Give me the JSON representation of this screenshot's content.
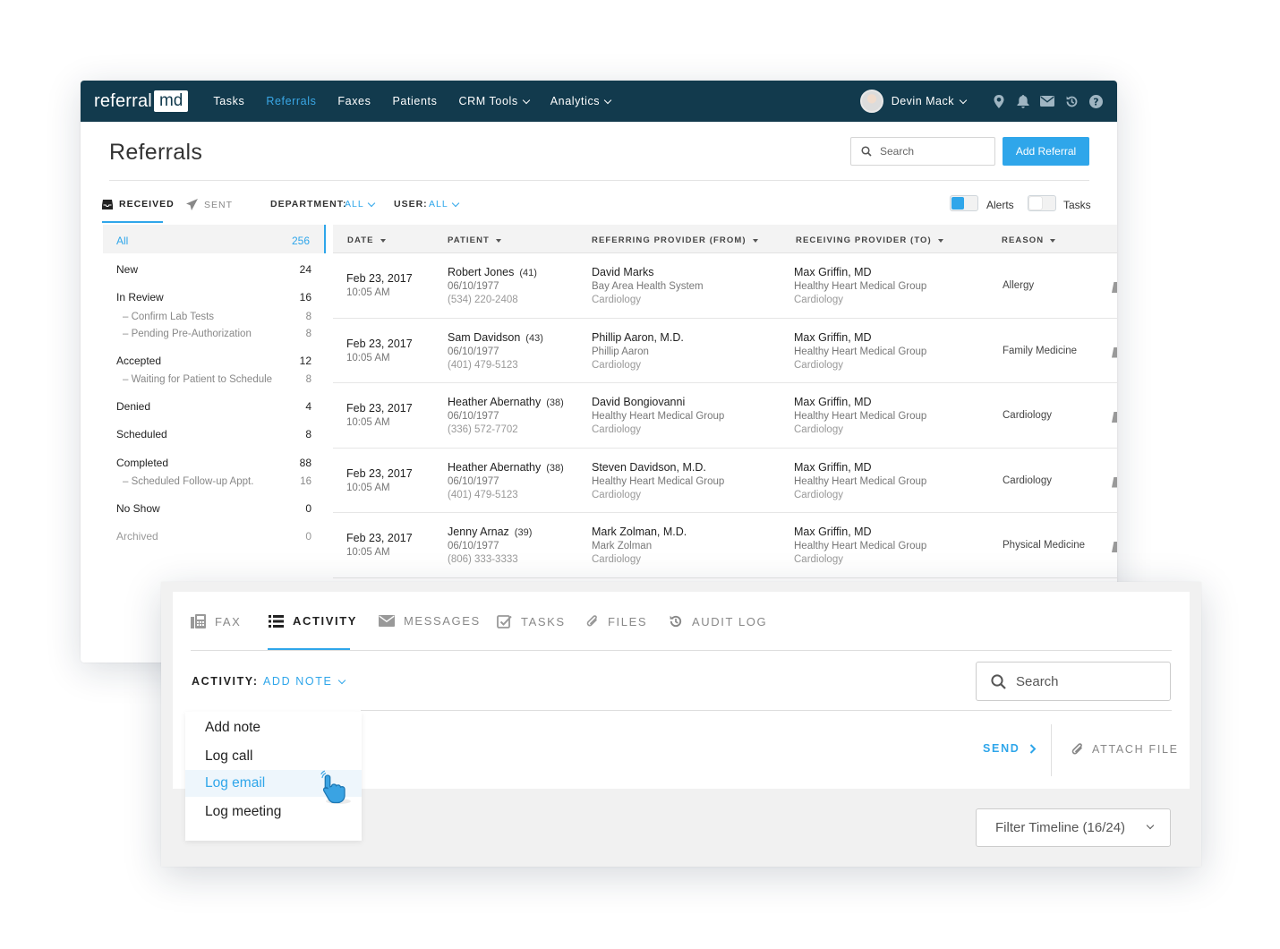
{
  "app": {
    "logo_text": "referral",
    "logo_box": "md"
  },
  "nav": {
    "items": [
      {
        "label": "Tasks",
        "active": false,
        "dropdown": false
      },
      {
        "label": "Referrals",
        "active": true,
        "dropdown": false
      },
      {
        "label": "Faxes",
        "active": false,
        "dropdown": false
      },
      {
        "label": "Patients",
        "active": false,
        "dropdown": false
      },
      {
        "label": "CRM Tools",
        "active": false,
        "dropdown": true
      },
      {
        "label": "Analytics",
        "active": false,
        "dropdown": true
      }
    ],
    "user_name": "Devin Mack",
    "icons": [
      "location-icon",
      "bell-icon",
      "mail-icon",
      "history-icon",
      "help-icon"
    ]
  },
  "header": {
    "title": "Referrals",
    "search_placeholder": "Search",
    "add_button": "Add Referral"
  },
  "filters": {
    "received": "RECEIVED",
    "sent": "SENT",
    "department_label": "DEPARTMENT:",
    "department_value": "ALL",
    "user_label": "USER:",
    "user_value": "ALL",
    "alerts_label": "Alerts",
    "alerts_on": true,
    "tasks_label": "Tasks",
    "tasks_on": false
  },
  "status_list": [
    {
      "label": "All",
      "count": "256",
      "type": "active"
    },
    {
      "label": "New",
      "count": "24",
      "type": "main"
    },
    {
      "label": "In Review",
      "count": "16",
      "type": "main"
    },
    {
      "label": "– Confirm Lab Tests",
      "count": "8",
      "type": "sub"
    },
    {
      "label": "– Pending Pre-Authorization",
      "count": "8",
      "type": "sub"
    },
    {
      "label": "Accepted",
      "count": "12",
      "type": "main"
    },
    {
      "label": "– Waiting for Patient to Schedule",
      "count": "8",
      "type": "sub"
    },
    {
      "label": "Denied",
      "count": "4",
      "type": "main"
    },
    {
      "label": "Scheduled",
      "count": "8",
      "type": "main"
    },
    {
      "label": "Completed",
      "count": "88",
      "type": "main"
    },
    {
      "label": "– Scheduled Follow-up Appt.",
      "count": "16",
      "type": "sub"
    },
    {
      "label": "No Show",
      "count": "0",
      "type": "main"
    },
    {
      "label": "Archived",
      "count": "0",
      "type": "muted"
    }
  ],
  "table": {
    "headers": [
      "DATE",
      "PATIENT",
      "REFERRING PROVIDER (FROM)",
      "RECEIVING PROVIDER (TO)",
      "REASON"
    ],
    "rows": [
      {
        "date": "Feb 23, 2017",
        "time": "10:05 AM",
        "patient": "Robert Jones",
        "age": "(41)",
        "dob": "06/10/1977",
        "phone": "(534) 220-2408",
        "from_name": "David Marks",
        "from_org": "Bay Area Health System",
        "from_dept": "Cardiology",
        "to_name": "Max Griffin, MD",
        "to_org": "Healthy Heart Medical Group",
        "to_dept": "Cardiology",
        "reason": "Allergy"
      },
      {
        "date": "Feb 23, 2017",
        "time": "10:05 AM",
        "patient": "Sam Davidson",
        "age": "(43)",
        "dob": "06/10/1977",
        "phone": "(401) 479-5123",
        "from_name": "Phillip Aaron, M.D.",
        "from_org": "Phillip Aaron",
        "from_dept": "Cardiology",
        "to_name": "Max Griffin, MD",
        "to_org": "Healthy Heart Medical Group",
        "to_dept": "Cardiology",
        "reason": "Family Medicine"
      },
      {
        "date": "Feb 23, 2017",
        "time": "10:05 AM",
        "patient": "Heather Abernathy",
        "age": "(38)",
        "dob": "06/10/1977",
        "phone": "(336) 572-7702",
        "from_name": "David Bongiovanni",
        "from_org": "Healthy Heart Medical Group",
        "from_dept": "Cardiology",
        "to_name": "Max Griffin, MD",
        "to_org": "Healthy Heart Medical Group",
        "to_dept": "Cardiology",
        "reason": "Cardiology"
      },
      {
        "date": "Feb 23, 2017",
        "time": "10:05 AM",
        "patient": "Heather Abernathy",
        "age": "(38)",
        "dob": "06/10/1977",
        "phone": "(401) 479-5123",
        "from_name": "Steven Davidson, M.D.",
        "from_org": "Healthy Heart Medical Group",
        "from_dept": "Cardiology",
        "to_name": "Max Griffin, MD",
        "to_org": "Healthy Heart Medical Group",
        "to_dept": "Cardiology",
        "reason": "Cardiology"
      },
      {
        "date": "Feb 23, 2017",
        "time": "10:05 AM",
        "patient": "Jenny Arnaz",
        "age": "(39)",
        "dob": "06/10/1977",
        "phone": "(806) 333-3333",
        "from_name": "Mark Zolman, M.D.",
        "from_org": "Mark Zolman",
        "from_dept": "Cardiology",
        "to_name": "Max Griffin, MD",
        "to_org": "Healthy Heart Medical Group",
        "to_dept": "Cardiology",
        "reason": "Physical Medicine"
      }
    ]
  },
  "panel": {
    "tabs": [
      {
        "label": "FAX",
        "icon": "fax-icon",
        "active": false
      },
      {
        "label": "ACTIVITY",
        "icon": "list-icon",
        "active": true
      },
      {
        "label": "MESSAGES",
        "icon": "envelope-icon",
        "active": false
      },
      {
        "label": "TASKS",
        "icon": "checkbox-icon",
        "active": false
      },
      {
        "label": "FILES",
        "icon": "paperclip-icon",
        "active": false
      },
      {
        "label": "AUDIT LOG",
        "icon": "history-icon",
        "active": false
      }
    ],
    "activity_label": "ACTIVITY:",
    "activity_value": "ADD NOTE",
    "search_placeholder": "Search",
    "send_label": "SEND",
    "attach_label": "ATTACH FILE",
    "filter_timeline": "Filter Timeline (16/24)",
    "dropdown_items": [
      "Add note",
      "Log call",
      "Log email",
      "Log meeting"
    ],
    "dropdown_hover": "Log email"
  },
  "colors": {
    "navbar": "#123a4d",
    "accent": "#2fa6ea",
    "panel_bg": "#f1f1f1"
  }
}
